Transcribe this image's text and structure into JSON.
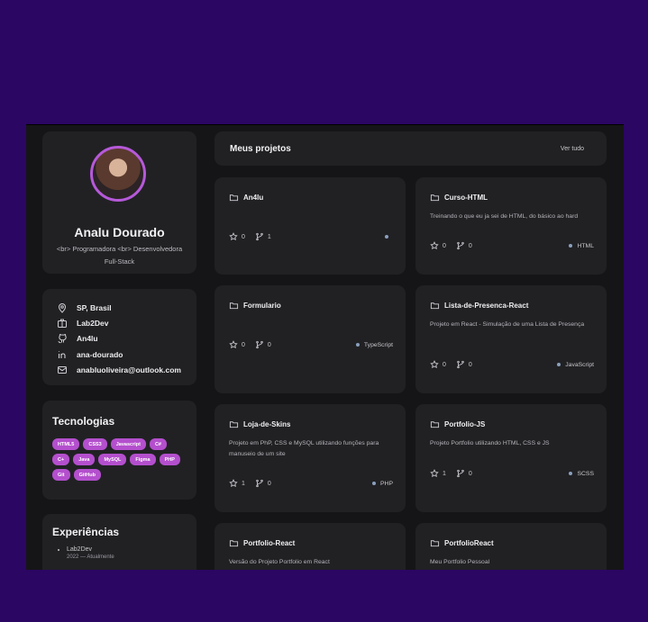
{
  "profile": {
    "name": "Analu Dourado",
    "bio": "<br> Programadora <br> Desenvolvedora Full-Stack"
  },
  "info": [
    {
      "icon": "location-icon",
      "text": "SP, Brasil"
    },
    {
      "icon": "briefcase-icon",
      "text": "Lab2Dev"
    },
    {
      "icon": "github-icon",
      "text": "An4lu"
    },
    {
      "icon": "linkedin-icon",
      "text": "ana-dourado"
    },
    {
      "icon": "mail-icon",
      "text": "anabluoliveira@outlook.com"
    }
  ],
  "technologies": {
    "title": "Tecnologias",
    "tags": [
      "HTML5",
      "CSS3",
      "Javascript",
      "C#",
      "C+",
      "Java",
      "MySQL",
      "Figma",
      "PHP",
      "Git",
      "GitHub"
    ]
  },
  "experiences": {
    "title": "Experiências",
    "items": [
      {
        "company": "Lab2Dev",
        "period": "2022 — Atualmente"
      }
    ]
  },
  "projects_header": {
    "title": "Meus projetos",
    "see_all": "Ver tudo"
  },
  "projects": [
    {
      "name": "An4lu",
      "description": "",
      "stars": "0",
      "forks": "1",
      "language": ""
    },
    {
      "name": "Curso-HTML",
      "description": "Treinando o que eu ja sei de HTML, do básico ao hard",
      "stars": "0",
      "forks": "0",
      "language": "HTML"
    },
    {
      "name": "Formulario",
      "description": "",
      "stars": "0",
      "forks": "0",
      "language": "TypeScript"
    },
    {
      "name": "Lista-de-Presenca-React",
      "description": "Projeto em React - Simulação de uma Lista de Presença",
      "stars": "0",
      "forks": "0",
      "language": "JavaScript"
    },
    {
      "name": "Loja-de-Skins",
      "description": "Projeto em PhP, CSS e MySQL utilizando funções para manuseio de um site",
      "stars": "1",
      "forks": "0",
      "language": "PHP"
    },
    {
      "name": "Portfolio-JS",
      "description": "Projeto Portfolio utilizando HTML, CSS e JS",
      "stars": "1",
      "forks": "0",
      "language": "SCSS"
    },
    {
      "name": "Portfolio-React",
      "description": "Versão do Projeto Portfolio em React",
      "stars": "",
      "forks": "",
      "language": ""
    },
    {
      "name": "PortfolioReact",
      "description": "Meu Portfolio Pessoal",
      "stars": "",
      "forks": "",
      "language": ""
    }
  ],
  "colors": {
    "background": "#2b0663",
    "panel": "#151517",
    "card": "#212124",
    "accent": "#b44fcd"
  }
}
